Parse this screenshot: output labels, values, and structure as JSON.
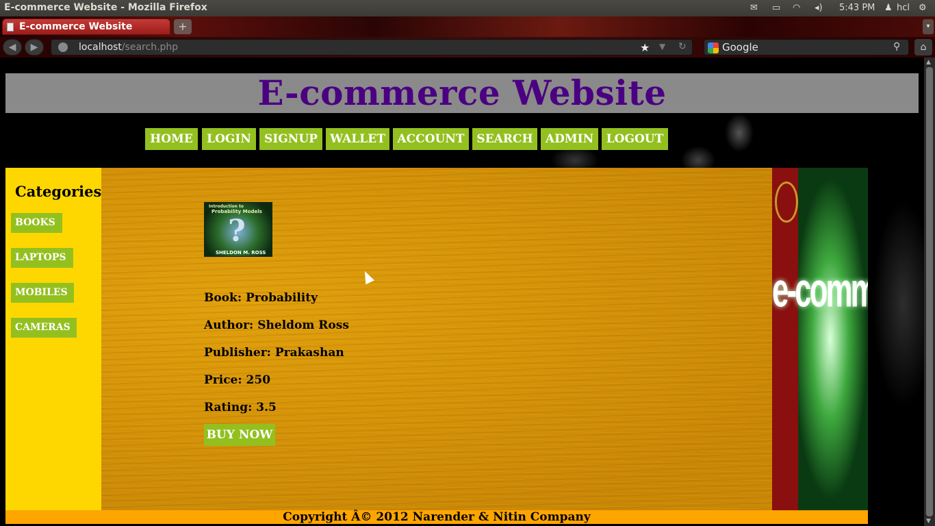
{
  "os": {
    "window_title": "E-commerce Website - Mozilla Firefox",
    "clock": "5:43 PM",
    "user": "hcl"
  },
  "browser": {
    "tab_title": "E-commerce Website",
    "new_tab_symbol": "+",
    "url_host": "localhost",
    "url_path": "/search.php",
    "search_engine": "Google"
  },
  "site": {
    "title": "E-commerce Website",
    "nav": [
      "HOME",
      "LOGIN",
      "SIGNUP",
      "WALLET",
      "ACCOUNT",
      "SEARCH",
      "ADMIN",
      "LOGOUT"
    ],
    "categories_heading": "Categories",
    "categories": [
      "BOOKS",
      "LAPTOPS",
      "MOBILES",
      "CAMERAS"
    ],
    "product": {
      "cover_top": "Introduction to",
      "cover_title": "Probability Models",
      "cover_author": "SHELDON M. ROSS",
      "book": "Book: Probability",
      "author": "Author: Sheldom Ross",
      "publisher": "Publisher: Prakashan",
      "price": "Price: 250",
      "rating": "Rating: 3.5",
      "buy_label": "BUY NOW"
    },
    "banner_text": "e-commerce",
    "footer": "Copyright Â© 2012 Narender & Nitin Company"
  },
  "colors": {
    "title_purple": "#4b0082",
    "nav_green": "#93c01f",
    "sidebar_yellow": "#ffd700",
    "footer_orange": "#ffa500",
    "header_gray": "#8a8a8a"
  },
  "icons": [
    "mail-icon",
    "battery-icon",
    "wifi-icon",
    "volume-icon",
    "user-icon",
    "gear-icon",
    "star-icon",
    "reload-icon",
    "search-icon",
    "home-icon",
    "back-icon",
    "forward-icon",
    "globe-icon",
    "mouse-cursor-icon"
  ]
}
